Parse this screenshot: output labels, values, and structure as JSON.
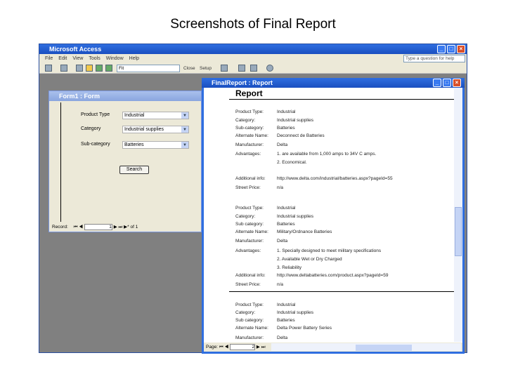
{
  "slide_title": "Screenshots of Final Report",
  "app": {
    "title": "Microsoft Access",
    "menu": [
      "File",
      "Edit",
      "View",
      "Tools",
      "Window",
      "Help"
    ],
    "help_placeholder": "Type a question for help",
    "toolbar": {
      "filter": "Fit",
      "close": "Close",
      "setup": "Setup"
    }
  },
  "form": {
    "title": "Form1 : Form",
    "fields": [
      {
        "label": "Product Type",
        "value": "Industrial"
      },
      {
        "label": "Category",
        "value": "Industrial supplies"
      },
      {
        "label": "Sub-category",
        "value": "Batteries"
      }
    ],
    "search_label": "Search",
    "nav": {
      "record_label": "Record:",
      "current": "1",
      "of": "of 1"
    }
  },
  "report": {
    "title": "FinalReport : Report",
    "heading": "Report",
    "records": [
      [
        {
          "l": "Product Type:",
          "v": "Industrial"
        },
        {
          "l": "Category:",
          "v": "Industrial supplies"
        },
        {
          "l": "Sub-category:",
          "v": "Batteries"
        },
        {
          "l": "Alternate Name:",
          "v": "Deconnect de Batteries"
        },
        {
          "l": "Manufacturer:",
          "v": "Delta"
        },
        {
          "l": "Advantages:",
          "v": "1. are available from 1,000 amps to 34V C amps."
        },
        {
          "l": "",
          "v": "2. Economical."
        },
        {
          "l": "Additional info:",
          "v": "http://www.delta.com/industrial/batteries.aspx?pageId=55"
        },
        {
          "l": "Street Price:",
          "v": "n/a"
        }
      ],
      [
        {
          "l": "Product Type:",
          "v": "Industrial"
        },
        {
          "l": "Category:",
          "v": "Industrial supplies"
        },
        {
          "l": "Sub category:",
          "v": "Batteries"
        },
        {
          "l": "Alternate Name:",
          "v": "Military/Ordnance Batteries"
        },
        {
          "l": "Manufacturer:",
          "v": "Delta"
        },
        {
          "l": "Advantages:",
          "v": "1. Specially designed to meet military specifications"
        },
        {
          "l": "",
          "v": "2. Available Wet or Dry Charged"
        },
        {
          "l": "",
          "v": "3. Reliability"
        },
        {
          "l": "Additional info:",
          "v": "http://www.deltabatteries.com/product.aspx?pageId=59"
        },
        {
          "l": "Street Price:",
          "v": "n/a"
        }
      ],
      [
        {
          "l": "Product Type:",
          "v": "Industrial"
        },
        {
          "l": "Category:",
          "v": "Industrial supplies"
        },
        {
          "l": "Sub category:",
          "v": "Batteries"
        },
        {
          "l": "Alternate Name:",
          "v": "Delta Power Battery Series"
        },
        {
          "l": "Manufacturer:",
          "v": "Delta"
        }
      ]
    ],
    "page_label": "Page:",
    "page": "2"
  }
}
